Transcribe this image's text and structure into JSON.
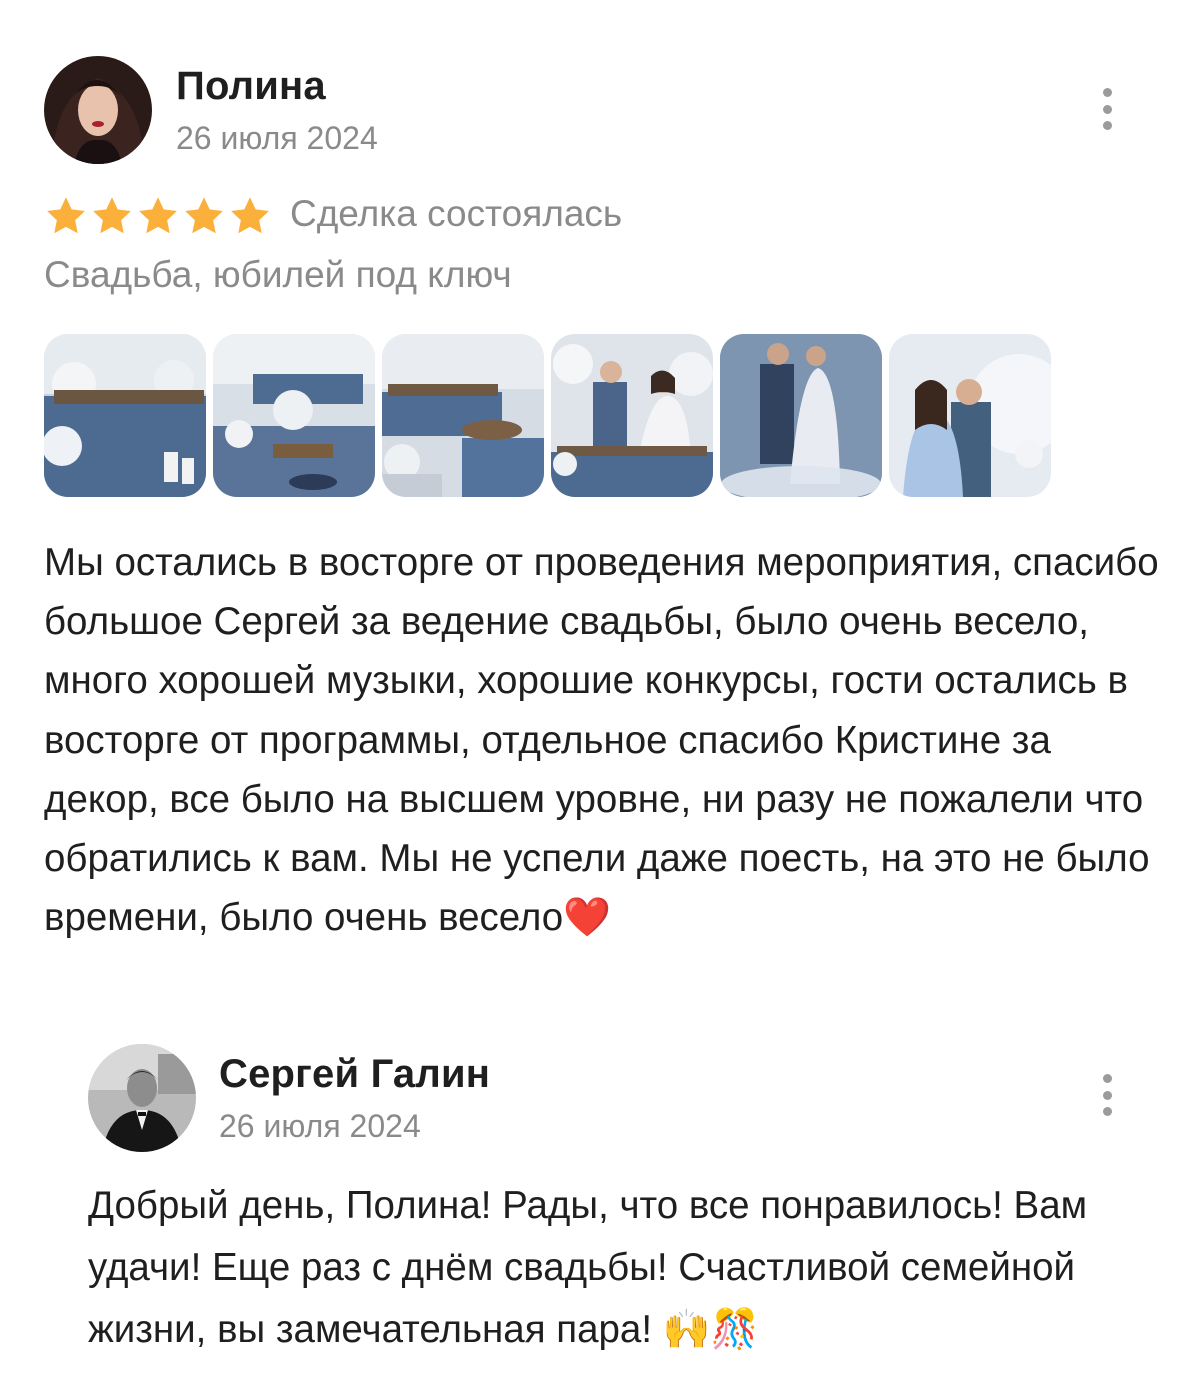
{
  "review": {
    "author": "Полина",
    "date": "26 июля 2024",
    "rating": 5,
    "deal_status": "Сделка состоялась",
    "category": "Свадьба, юбилей под ключ",
    "photos": [
      "banquet-table-photo",
      "table-setting-photo",
      "decorated-tables-photo",
      "couple-at-table-photo",
      "first-dance-photo",
      "couple-portrait-photo"
    ],
    "text": "Мы остались в восторге от проведения мероприятия, спасибо большое Сергей за ведение свадьбы, было очень весело, много хорошей музыки, хорошие конкурсы, гости остались в восторге от программы, отдельное спасибо Кристине за декор, все было на высшем уровне, ни разу не пожалели что обратились к вам. Мы не успели даже поесть, на это не было времени, было очень весело",
    "text_emoji": "❤️"
  },
  "reply": {
    "author": "Сергей Галин",
    "date": "26 июля 2024",
    "text": "Добрый день, Полина! Рады, что все понравилось! Вам удачи! Еще раз с днём свадьбы! Счастливой семейной жизни, вы замечательная пара!",
    "text_emoji": "🙌🎊"
  },
  "colors": {
    "star": "#fbb03b",
    "muted_text": "#8a8a8a",
    "main_text": "#1f1f1f"
  }
}
